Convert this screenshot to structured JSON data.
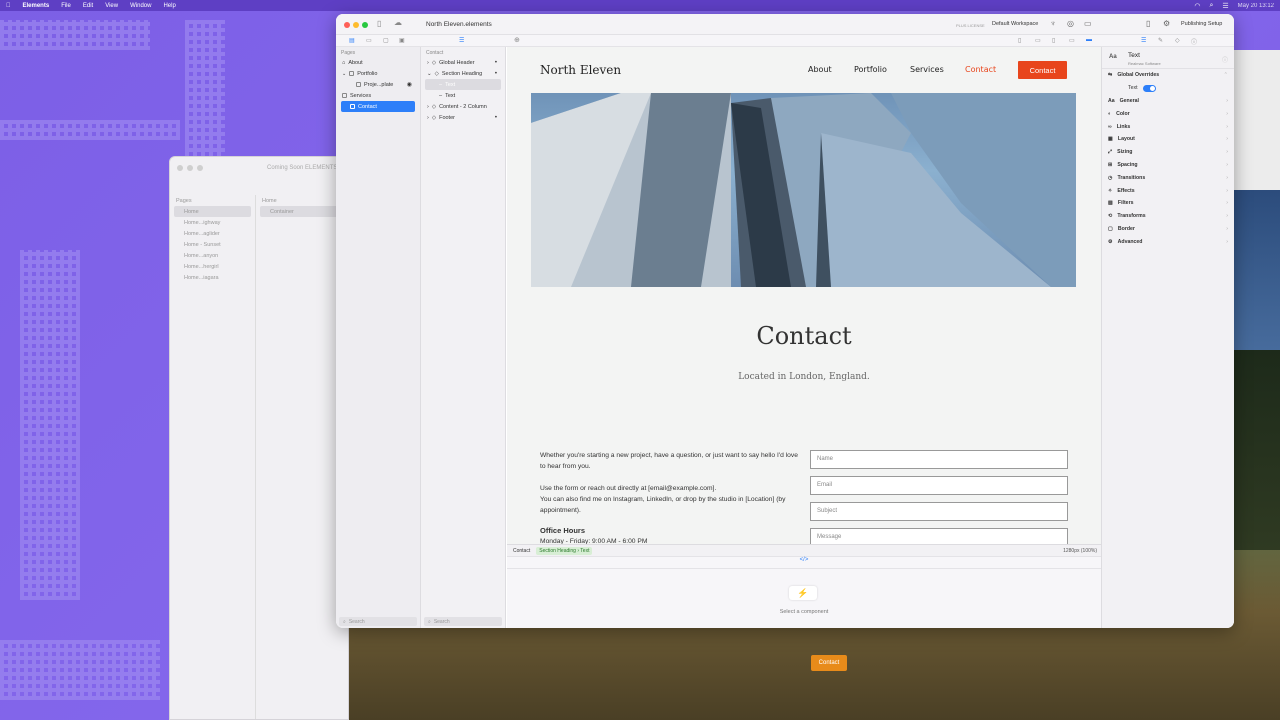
{
  "menubar": {
    "app": "Elements",
    "items": [
      "File",
      "Edit",
      "View",
      "Window",
      "Help"
    ],
    "clock": "May 20  13:12"
  },
  "window": {
    "title": "North Eleven.elements",
    "license": "PLUS LICENSE",
    "workspace": "Default Workspace",
    "publishing": "Publishing Setup"
  },
  "back_window": {
    "title": "Coming Soon  ELEMENTS",
    "pages_label": "Pages",
    "pages": [
      "Home",
      "Home...ighway",
      "Home...aglider",
      "Home - Sunset",
      "Home...anyon",
      "Home...hergirl",
      "Home...iagara"
    ],
    "layers_label": "Home",
    "layer": "Container"
  },
  "pages": {
    "label": "Pages",
    "items": [
      "About",
      "Portfolio",
      "Proje...plate",
      "Services",
      "Contact"
    ],
    "search_placeholder": "Search"
  },
  "layers": {
    "label": "Contact",
    "items": [
      "Global Header",
      "Section Heading",
      "Text",
      "Text",
      "Content - 2 Column",
      "Footer"
    ],
    "search_placeholder": "Search"
  },
  "site": {
    "logo": "North Eleven",
    "nav": [
      "About",
      "Portfolio",
      "Services",
      "Contact"
    ],
    "cta": "Contact",
    "heading": "Contact",
    "subheading": "Located in London, England.",
    "para1": "Whether you're starting a new project, have a question, or just want to say hello I'd love to hear from you.",
    "para2a": "Use the form or reach out directly at [email@example.com].",
    "para2b": "You can also find me on Instagram, LinkedIn, or drop by the studio in [Location] (by appointment).",
    "office_title": "Office Hours",
    "office_hours": "Monday - Friday: 9:00 AM - 6:00 PM",
    "fields": [
      "Name",
      "Email",
      "Subject",
      "Message"
    ]
  },
  "status": {
    "page": "Contact",
    "crumbs": [
      "Section Heading",
      "Text"
    ],
    "size": "1280px (100%)",
    "code": "</>"
  },
  "bottom": {
    "select": "Select a component"
  },
  "inspector": {
    "title": "Text",
    "subtitle": "Realmac Software",
    "overrides": "Global Overrides",
    "toggle_label": "Text",
    "sections": [
      "General",
      "Color",
      "Links",
      "Layout",
      "Sizing",
      "Spacing",
      "Transitions",
      "Effects",
      "Filters",
      "Transforms",
      "Border",
      "Advanced"
    ]
  },
  "photo_window": {
    "button": "Contact"
  },
  "colors": {
    "accent": "#2d7ff9",
    "cta": "#e8451c",
    "desktop": "#7f63e8"
  }
}
